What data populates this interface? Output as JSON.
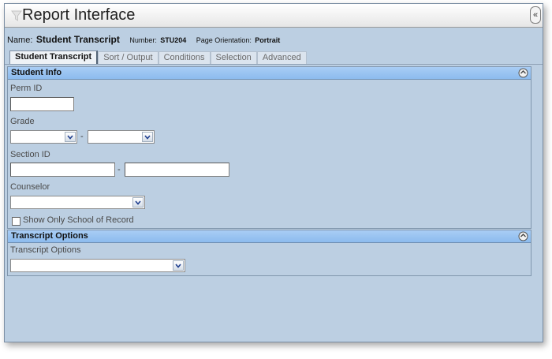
{
  "window": {
    "title": "Report Interface",
    "collapse_symbol": "«"
  },
  "meta": {
    "name_label": "Name:",
    "name_value": "Student Transcript",
    "number_label": "Number:",
    "number_value": "STU204",
    "orientation_label": "Page Orientation:",
    "orientation_value": "Portrait"
  },
  "tabs": [
    {
      "label": "Student Transcript",
      "active": true
    },
    {
      "label": "Sort / Output",
      "active": false
    },
    {
      "label": "Conditions",
      "active": false
    },
    {
      "label": "Selection",
      "active": false
    },
    {
      "label": "Advanced",
      "active": false
    }
  ],
  "student_info": {
    "title": "Student Info",
    "perm_id": {
      "label": "Perm ID",
      "value": ""
    },
    "grade": {
      "label": "Grade",
      "from": "",
      "to": "",
      "separator": "-"
    },
    "section_id": {
      "label": "Section ID",
      "from": "",
      "to": "",
      "separator": "-"
    },
    "counselor": {
      "label": "Counselor",
      "value": ""
    },
    "show_only_school": {
      "label": "Show Only School of Record",
      "checked": false
    }
  },
  "transcript_options": {
    "title": "Transcript Options",
    "field": {
      "label": "Transcript Options",
      "value": ""
    }
  },
  "icons": {
    "title": "funnel-icon",
    "collapse": "double-chevron-left-icon",
    "section_toggle": "circle-arrow-icon",
    "dropdown": "chevron-down-icon"
  },
  "colors": {
    "panel_bg": "#bccfe2",
    "section_header": "#96c2f0",
    "border": "#8096ad"
  }
}
